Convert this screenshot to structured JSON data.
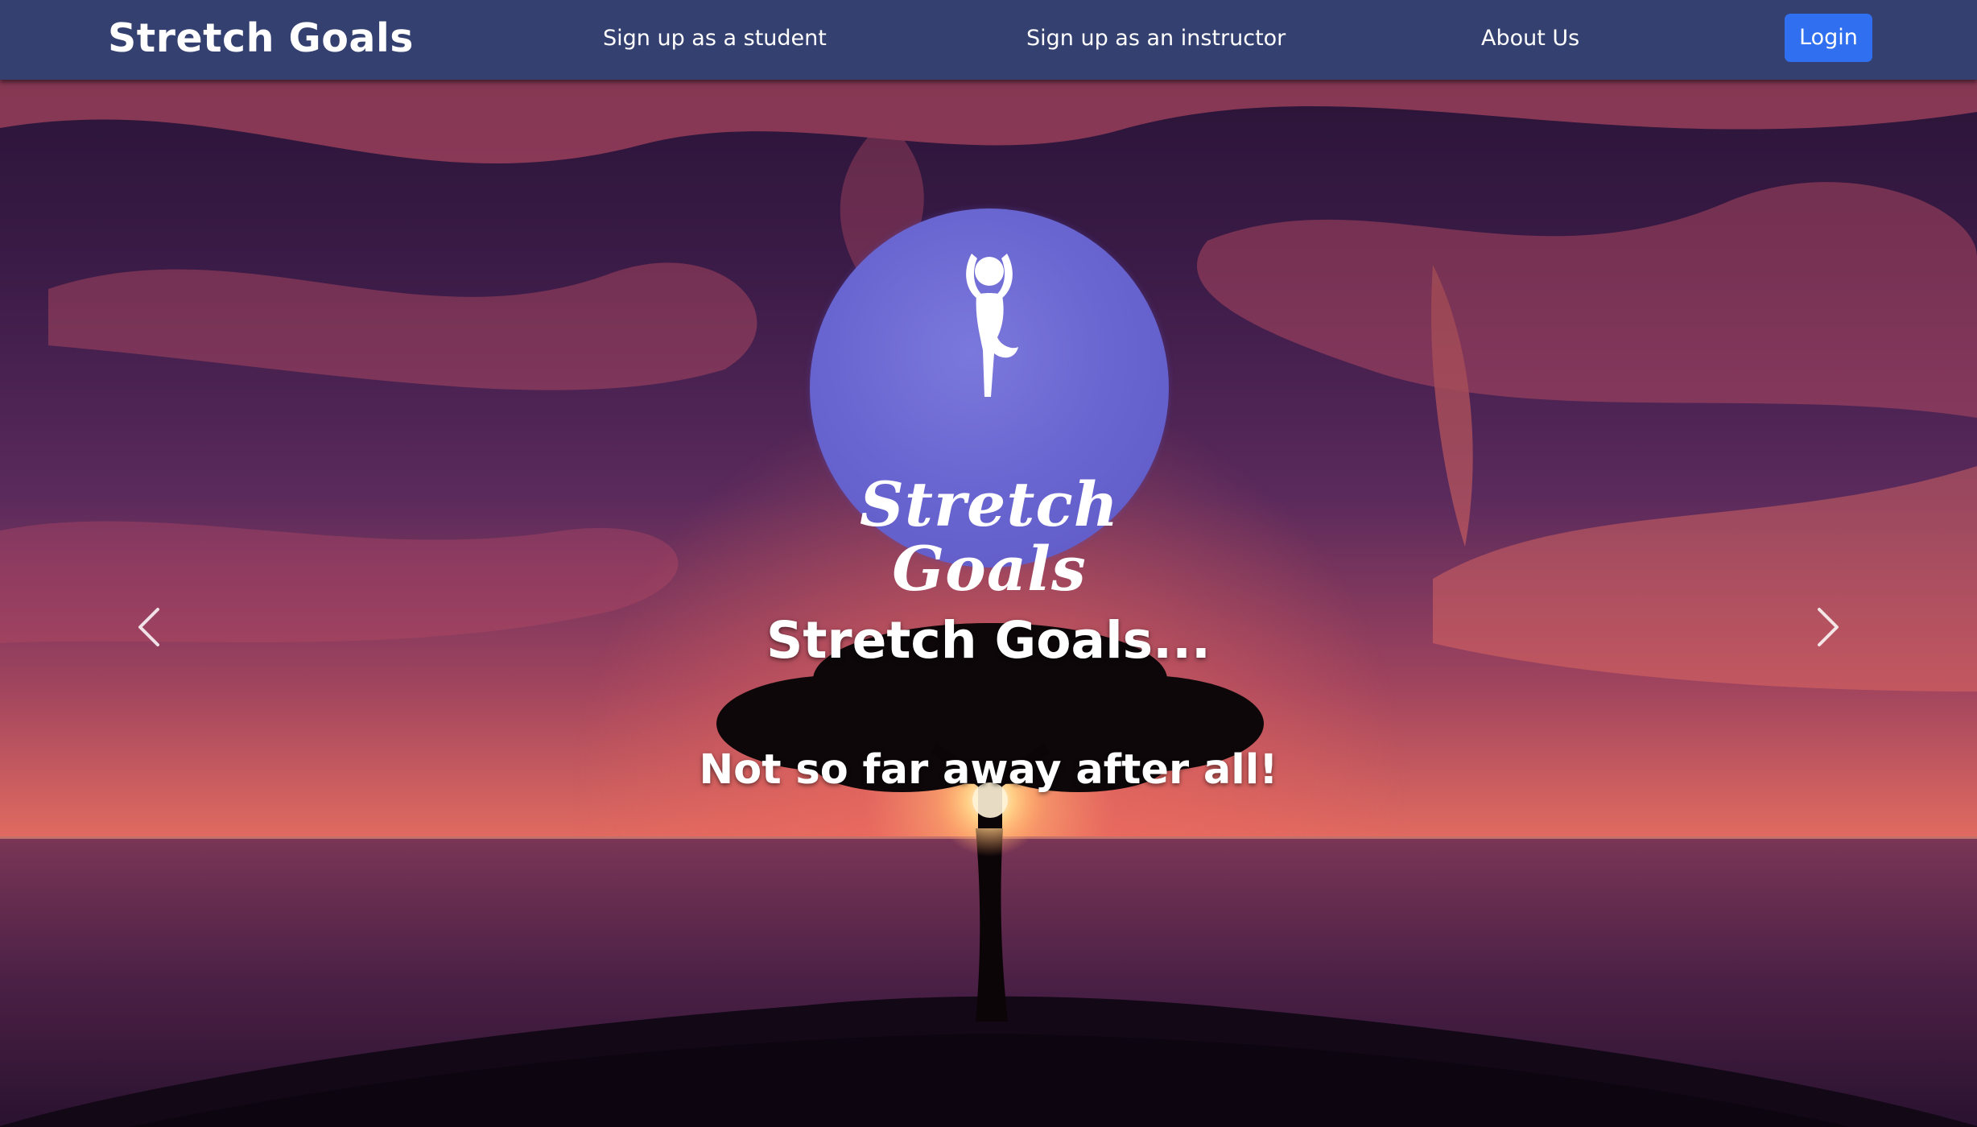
{
  "navbar": {
    "brand": "Stretch Goals",
    "links": [
      {
        "label": "Sign up as a student"
      },
      {
        "label": "Sign up as an instructor"
      },
      {
        "label": "About Us"
      }
    ],
    "login_label": "Login",
    "colors": {
      "background": "#34406f",
      "login_button": "#2f6ff0"
    }
  },
  "hero": {
    "logo": {
      "line1": "Stretch",
      "line2": "Goals",
      "circle_color": "#6763cf",
      "figure_icon": "yoga-tree-pose-icon"
    },
    "title": "Stretch Goals...",
    "subtitle": "Not so far away after all!",
    "carousel": {
      "prev_icon": "chevron-left-icon",
      "next_icon": "chevron-right-icon"
    }
  }
}
